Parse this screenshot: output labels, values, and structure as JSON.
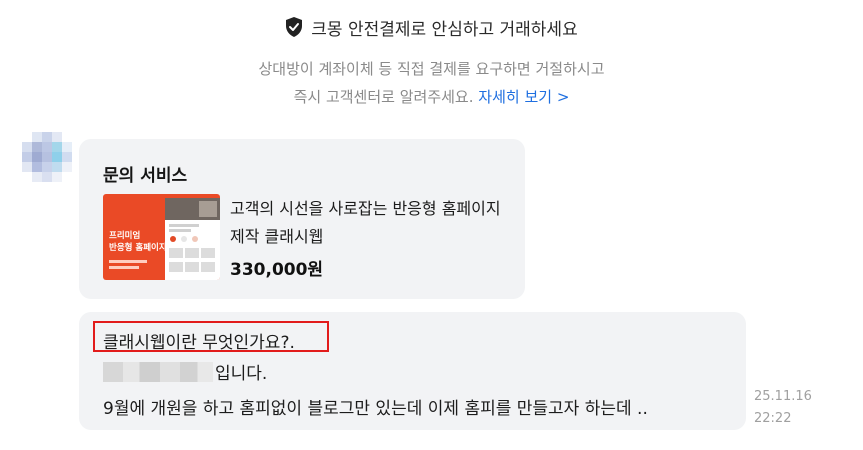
{
  "notice": {
    "title": "크몽 안전결제로 안심하고 거래하세요",
    "line1": "상대방이 계좌이체 등 직접 결제를 요구하면 거절하시고",
    "line2_text": "즉시 고객센터로 알려주세요.",
    "detail_link": "자세히 보기 >",
    "link_color": "#1f6fe0"
  },
  "service_card": {
    "title": "문의 서비스",
    "thumbnail_text_line1": "프리미엄",
    "thumbnail_text_line2": "반응형 홈페이지",
    "product_name": "고객의 시선을 사로잡는 반응형 홈페이지 제작 클래시웹",
    "price": "330,000원",
    "thumbnail_color": "#ea4a26"
  },
  "message": {
    "question": "클래시웹이란 무엇인가요?.",
    "intro_suffix": "입니다.",
    "body": "9월에 개원을 하고 홈피없이 블로그만 있는데 이제 홈피를 만들고자 하는데 ..",
    "date": "25.11.16",
    "time": "22:22",
    "highlight_color": "#e21b1b"
  }
}
